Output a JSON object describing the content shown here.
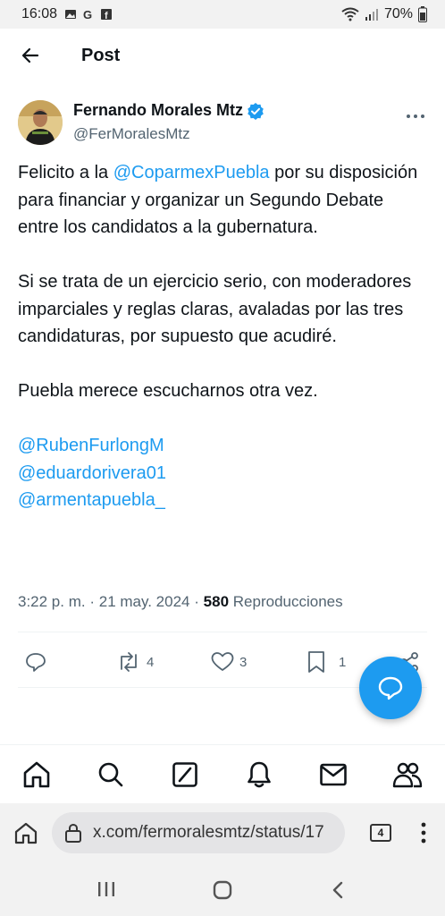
{
  "status_bar": {
    "time": "16:08",
    "battery": "70%",
    "icons": [
      "gallery-icon",
      "google-icon",
      "facebook-icon",
      "wifi-icon",
      "signal-icon",
      "battery-icon"
    ]
  },
  "header": {
    "title": "Post"
  },
  "post": {
    "author_name": "Fernando Morales Mtz",
    "author_handle": "@FerMoralesMtz",
    "verified": true,
    "paragraph1": {
      "before": "Felicito a la ",
      "mention": "@CoparmexPuebla",
      "after": " por su disposición para financiar y organizar un Segundo Debate entre los candidatos a la gubernatura."
    },
    "paragraph2": "Si se trata de un ejercicio serio, con moderadores imparciales y reglas claras, avaladas por las tres candidaturas, por supuesto que acudiré.",
    "paragraph3": "Puebla merece escucharnos otra vez.",
    "mentions": [
      "@RubenFurlongM",
      "@eduardorivera01",
      "@armentapuebla_"
    ],
    "time": "3:22 p. m.",
    "date": "21 may. 2024",
    "separator": "·",
    "views_count": "580",
    "views_label": "Reproducciones",
    "reposts": "4",
    "likes": "3",
    "bookmarks": "1"
  },
  "browser": {
    "url": "x.com/fermoralesmtz/status/17",
    "tab_count": "4"
  },
  "colors": {
    "accent": "#1d9bf0",
    "text": "#0f1419",
    "muted": "#536471"
  }
}
